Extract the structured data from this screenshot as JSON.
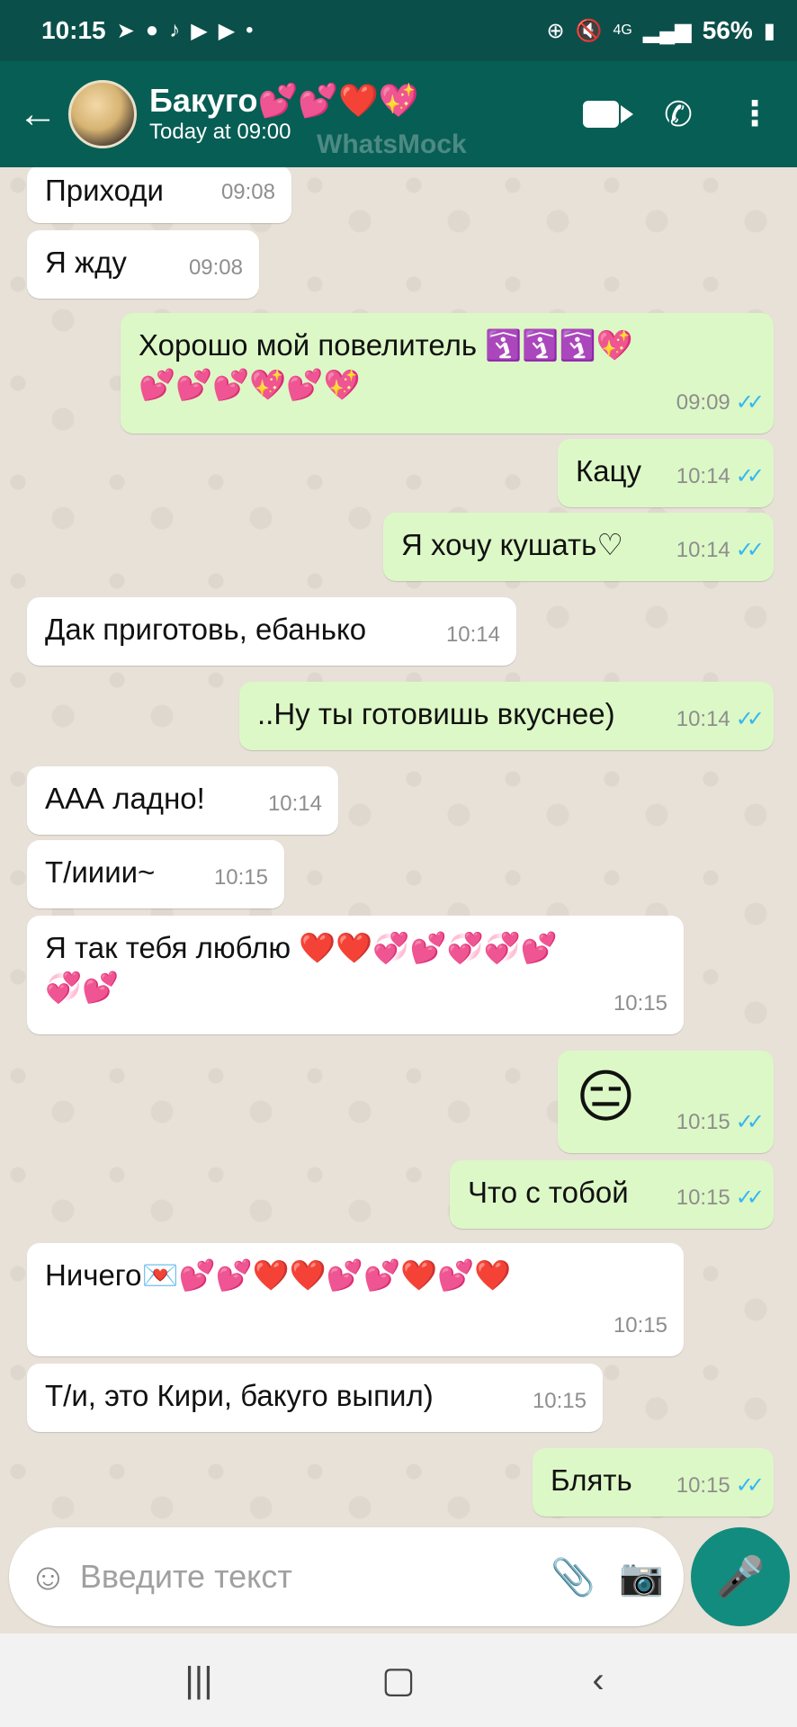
{
  "status_bar": {
    "time": "10:15",
    "left_icons": [
      "telegram-icon",
      "message-icon",
      "tiktok-icon",
      "youtube-icon",
      "youtube-icon",
      "dot-icon"
    ],
    "network": "4G",
    "battery": "56%"
  },
  "header": {
    "contact_name": "Бакуго💕💕❤️💖",
    "status": "Today at 09:00",
    "watermark": "WhatsMock"
  },
  "messages": [
    {
      "dir": "in",
      "text": "Приходи",
      "time": "09:08"
    },
    {
      "dir": "in",
      "text": "Я жду",
      "time": "09:08"
    },
    {
      "dir": "out",
      "text": "Хорошо мой повелитель 🛐🛐🛐💖💕💕💕💖💕💖",
      "time": "09:09"
    },
    {
      "dir": "out",
      "text": "Кацу",
      "time": "10:14"
    },
    {
      "dir": "out",
      "text": "Я хочу кушать♡",
      "time": "10:14"
    },
    {
      "dir": "in",
      "text": "Дак приготовь, ебанько",
      "time": "10:14"
    },
    {
      "dir": "out",
      "text": "..Ну ты готовишь вкуснее)",
      "time": "10:14"
    },
    {
      "dir": "in",
      "text": "ААА ладно!",
      "time": "10:14"
    },
    {
      "dir": "in",
      "text": "Т/ииии~",
      "time": "10:15"
    },
    {
      "dir": "in",
      "text": "Я так тебя люблю ❤️❤️💞💕💞💞💕💞💕",
      "time": "10:15"
    },
    {
      "dir": "out",
      "text": "😑",
      "time": "10:15"
    },
    {
      "dir": "out",
      "text": "Что с тобой",
      "time": "10:15"
    },
    {
      "dir": "in",
      "text": "Ничего💌💕💕❤️❤️💕💕❤️💕❤️",
      "time": "10:15"
    },
    {
      "dir": "in",
      "text": "Т/и, это Кири, бакуго выпил)",
      "time": "10:15"
    },
    {
      "dir": "out",
      "text": "Блять",
      "time": "10:15"
    }
  ],
  "input": {
    "placeholder": "Введите текст"
  },
  "colors": {
    "header": "#075e54",
    "status_bar": "#0b4f4a",
    "outgoing_bubble": "#dcf8c6",
    "incoming_bubble": "#ffffff",
    "tick_read": "#34b7f1",
    "mic_button": "#128c7e"
  }
}
